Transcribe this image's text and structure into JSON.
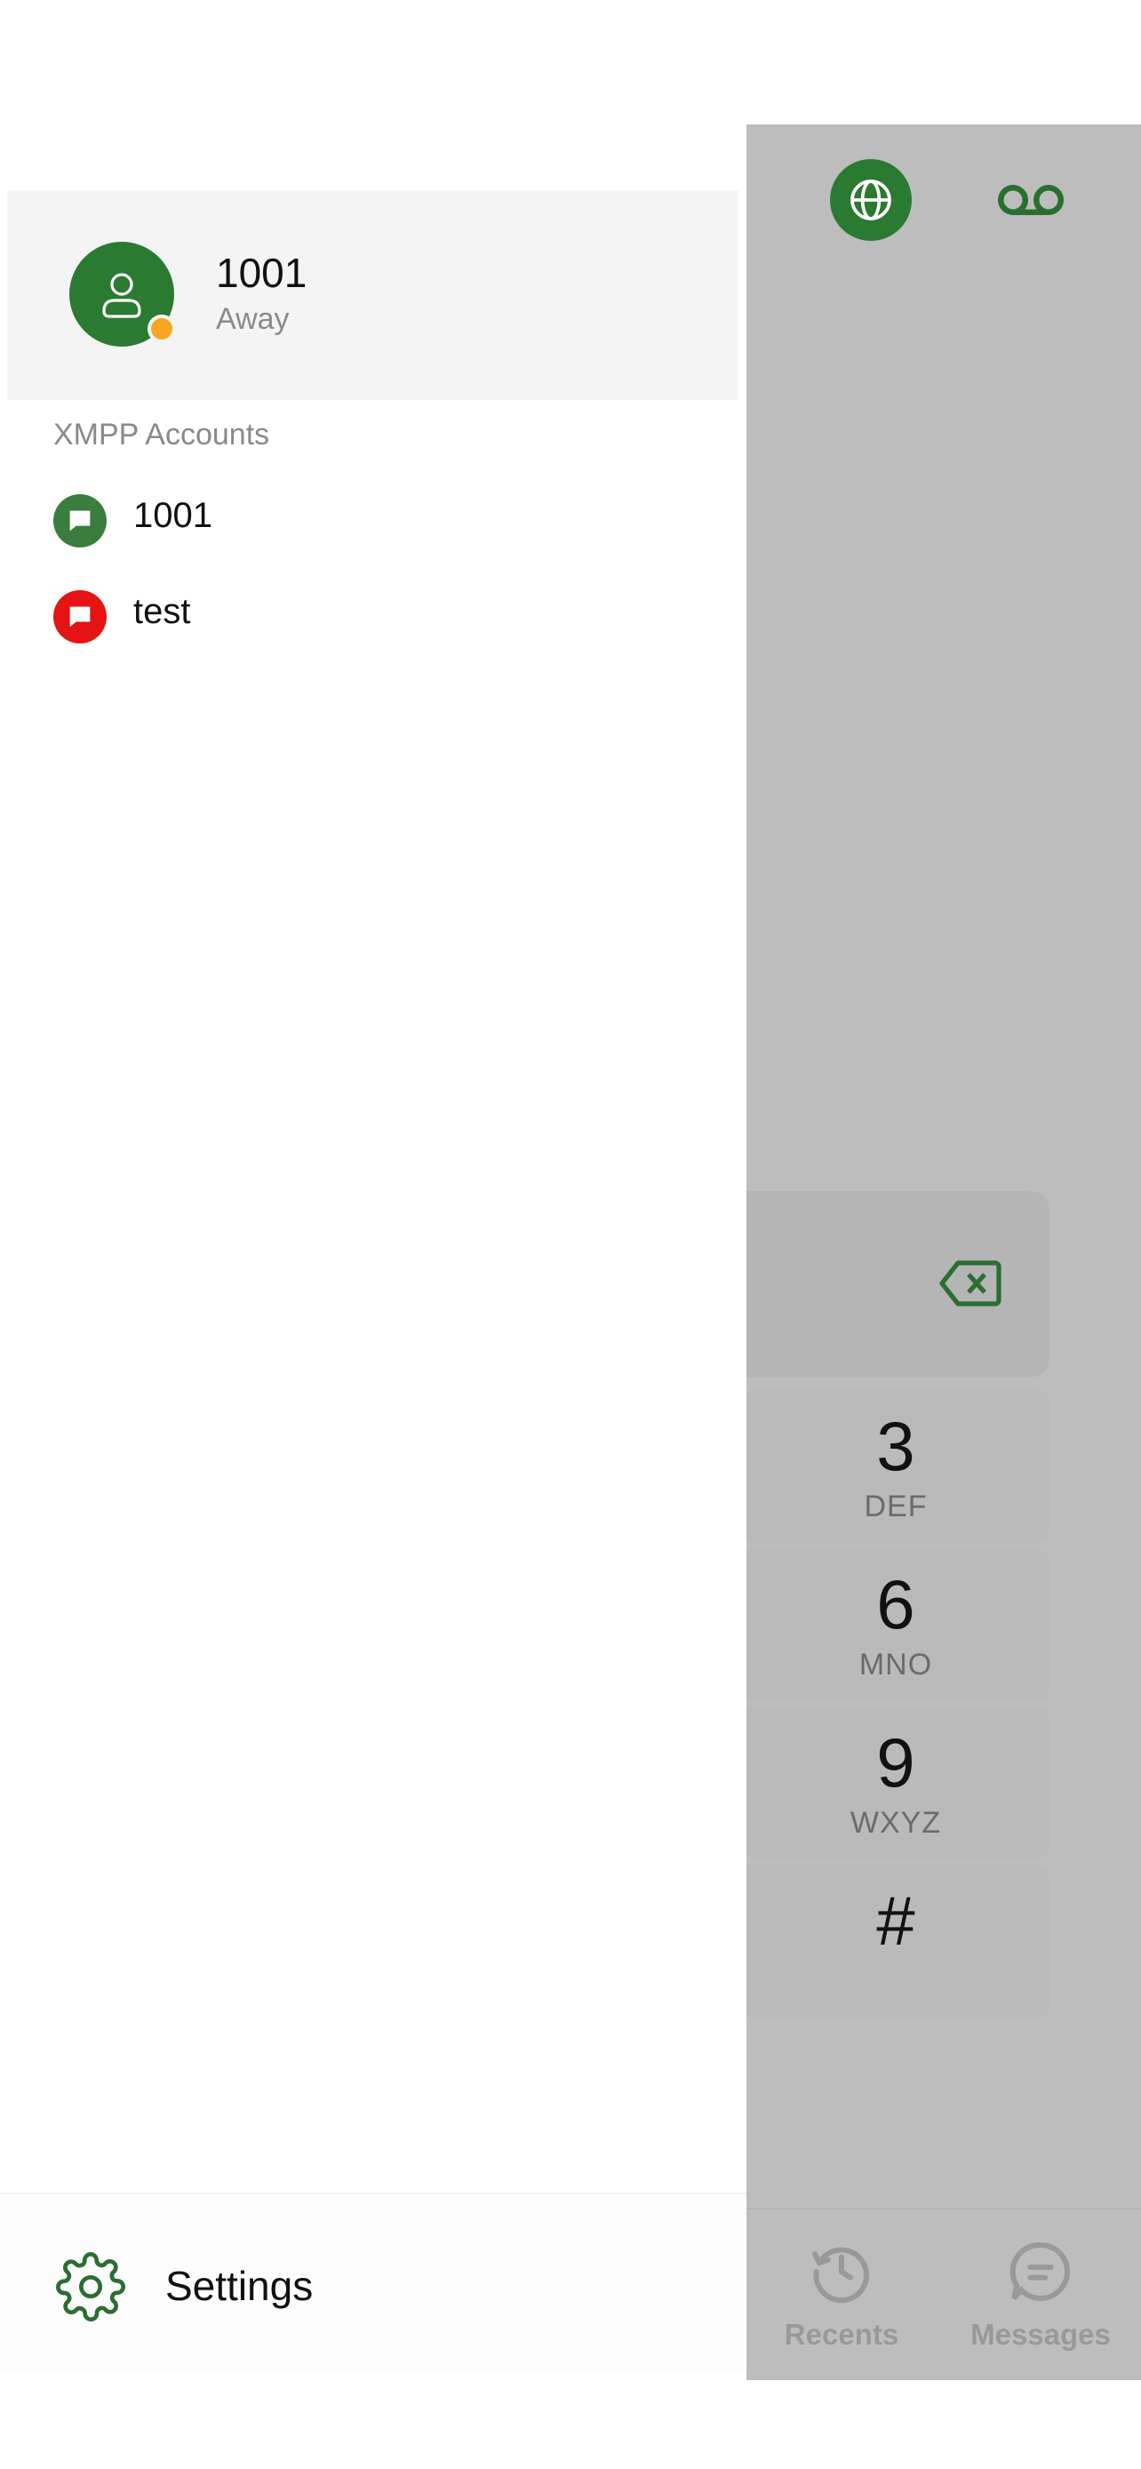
{
  "drawer": {
    "profile": {
      "name": "1001",
      "status": "Away",
      "presence_color": "#f5a623"
    },
    "accounts_header": "XMPP Accounts",
    "accounts": [
      {
        "label": "1001",
        "icon": "chat-bubble-icon",
        "color": "#3b7d3f"
      },
      {
        "label": "test",
        "icon": "chat-bubble-icon",
        "color": "#e51414"
      }
    ],
    "footer": {
      "settings_label": "Settings",
      "icon": "gear-icon"
    }
  },
  "background_app": {
    "top_icons": [
      "globe-icon",
      "voicemail-icon"
    ],
    "dialpad": {
      "backspace_icon": "backspace-icon",
      "keys": [
        {
          "digit": "3",
          "letters": "DEF"
        },
        {
          "digit": "6",
          "letters": "MNO"
        },
        {
          "digit": "9",
          "letters": "WXYZ"
        },
        {
          "digit": "#",
          "letters": ""
        }
      ]
    },
    "bottom_nav": [
      {
        "label": "Recents",
        "icon": "history-icon"
      },
      {
        "label": "Messages",
        "icon": "message-icon"
      }
    ]
  },
  "colors": {
    "brand_green": "#2a7a32",
    "overlay_gray": "#bdbdbd"
  }
}
